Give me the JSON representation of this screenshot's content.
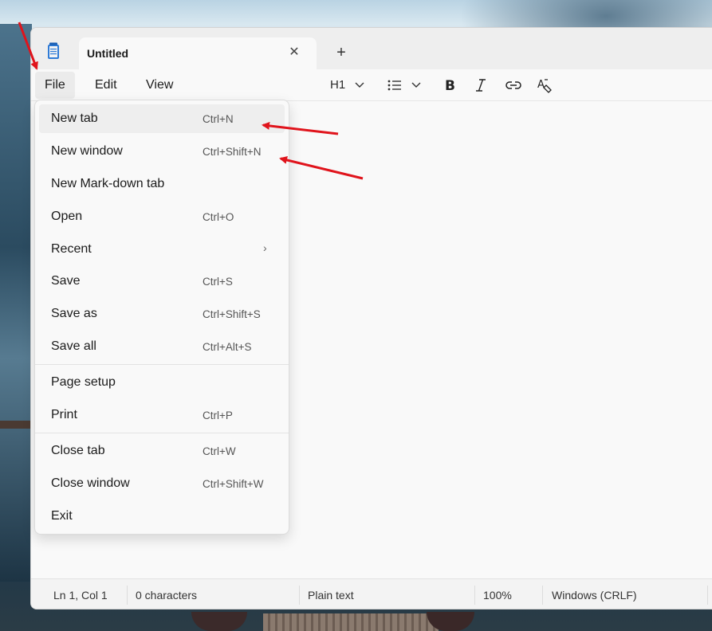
{
  "tab": {
    "title": "Untitled",
    "close_glyph": "✕",
    "new_tab_glyph": "+"
  },
  "menubar": {
    "file": "File",
    "edit": "Edit",
    "view": "View"
  },
  "toolbar": {
    "heading": "H1",
    "icons": [
      "chevron-down-icon",
      "bulleted-list-icon",
      "bold-icon",
      "italic-icon",
      "link-icon",
      "clear-formatting-icon"
    ]
  },
  "file_menu": {
    "items": [
      {
        "label": "New tab",
        "shortcut": "Ctrl+N"
      },
      {
        "label": "New window",
        "shortcut": "Ctrl+Shift+N"
      },
      {
        "label": "New Mark-down tab",
        "shortcut": ""
      },
      {
        "label": "Open",
        "shortcut": "Ctrl+O"
      },
      {
        "label": "Recent",
        "shortcut": ""
      },
      {
        "label": "Save",
        "shortcut": "Ctrl+S"
      },
      {
        "label": "Save as",
        "shortcut": "Ctrl+Shift+S"
      },
      {
        "label": "Save all",
        "shortcut": "Ctrl+Alt+S"
      },
      {
        "label": "Page setup",
        "shortcut": ""
      },
      {
        "label": "Print",
        "shortcut": "Ctrl+P"
      },
      {
        "label": "Close tab",
        "shortcut": "Ctrl+W"
      },
      {
        "label": "Close window",
        "shortcut": "Ctrl+Shift+W"
      },
      {
        "label": "Exit",
        "shortcut": ""
      }
    ],
    "recent_chevron": "›"
  },
  "statusbar": {
    "position": "Ln 1, Col 1",
    "characters": "0 characters",
    "format": "Plain text",
    "zoom": "100%",
    "line_ending": "Windows (CRLF)"
  },
  "colors": {
    "annotation_arrow": "#e0141c",
    "window_bg": "#f9f9f9",
    "titlebar_bg": "#eeeeee"
  }
}
